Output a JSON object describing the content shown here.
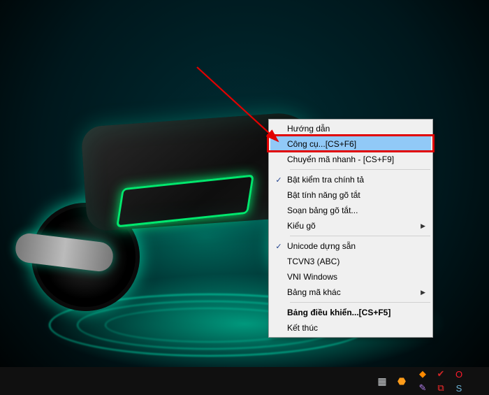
{
  "menu": {
    "items": [
      {
        "label": "Hướng dẫn",
        "checked": false,
        "submenu": false,
        "highlighted": false,
        "bold": false
      },
      {
        "label": "Công cụ...[CS+F6]",
        "checked": false,
        "submenu": false,
        "highlighted": true,
        "bold": false
      },
      {
        "label": "Chuyển mã nhanh - [CS+F9]",
        "checked": false,
        "submenu": false,
        "highlighted": false,
        "bold": false
      }
    ],
    "group2": [
      {
        "label": "Bật kiểm tra chính tả",
        "checked": true,
        "submenu": false
      },
      {
        "label": "Bật tính năng gõ tắt",
        "checked": false,
        "submenu": false
      },
      {
        "label": "Soạn bảng gõ tắt...",
        "checked": false,
        "submenu": false
      },
      {
        "label": "Kiểu gõ",
        "checked": false,
        "submenu": true
      }
    ],
    "group3": [
      {
        "label": "Unicode dựng sẵn",
        "checked": true,
        "submenu": false
      },
      {
        "label": "TCVN3 (ABC)",
        "checked": false,
        "submenu": false
      },
      {
        "label": "VNI Windows",
        "checked": false,
        "submenu": false
      },
      {
        "label": "Bảng mã khác",
        "checked": false,
        "submenu": true
      }
    ],
    "group4": [
      {
        "label": "Bảng điều khiển...[CS+F5]",
        "checked": false,
        "submenu": false,
        "bold": true
      },
      {
        "label": "Kết thúc",
        "checked": false,
        "submenu": false,
        "bold": false
      }
    ]
  },
  "tray": {
    "lead": [
      {
        "name": "app-icon",
        "glyph": "▦",
        "color": "#cfd3d6"
      },
      {
        "name": "security-icon",
        "glyph": "⬣",
        "color": "#ff9c1a"
      }
    ],
    "icons": [
      {
        "name": "avast-icon",
        "glyph": "◆",
        "color": "#ff8a00"
      },
      {
        "name": "shield-icon",
        "glyph": "✔",
        "color": "#d02626"
      },
      {
        "name": "opera-icon",
        "glyph": "O",
        "color": "#ff1b2d"
      },
      {
        "name": "blank-icon",
        "glyph": "",
        "color": "#000"
      },
      {
        "name": "feather-icon",
        "glyph": "✎",
        "color": "#b07de8"
      },
      {
        "name": "record-icon",
        "glyph": "⧉",
        "color": "#ff2b2b"
      },
      {
        "name": "skype-icon",
        "glyph": "S",
        "color": "#6bb3d6"
      },
      {
        "name": "blank2-icon",
        "glyph": "",
        "color": "#000"
      }
    ]
  }
}
